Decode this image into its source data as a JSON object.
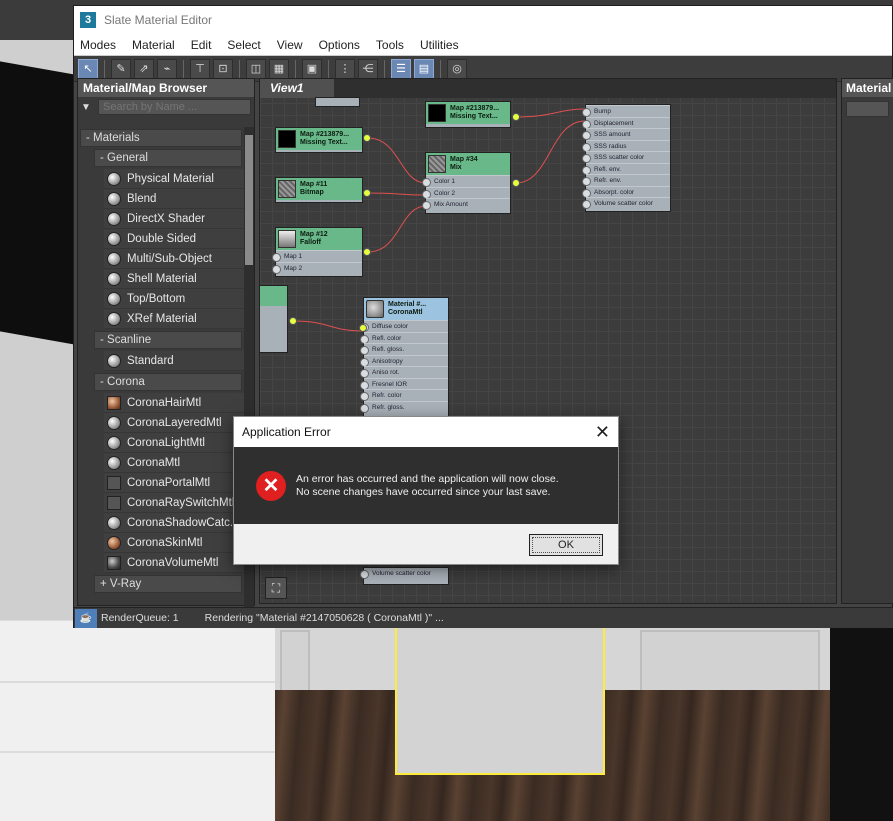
{
  "window": {
    "title": "Slate Material Editor",
    "app_icon": "3"
  },
  "menu": [
    "Modes",
    "Material",
    "Edit",
    "Select",
    "View",
    "Options",
    "Tools",
    "Utilities"
  ],
  "browser": {
    "title": "Material/Map Browser",
    "search_placeholder": "Search by Name ...",
    "groups": {
      "materials": "- Materials",
      "general": "- General",
      "scanline": "- Scanline",
      "corona": "- Corona",
      "vray": "+ V-Ray"
    },
    "general_items": [
      "Physical Material",
      "Blend",
      "DirectX Shader",
      "Double Sided",
      "Multi/Sub-Object",
      "Shell Material",
      "Top/Bottom",
      "XRef Material"
    ],
    "scanline_items": [
      "Standard"
    ],
    "corona_items": [
      "CoronaHairMtl",
      "CoronaLayeredMtl",
      "CoronaLightMtl",
      "CoronaMtl",
      "CoronaPortalMtl",
      "CoronaRaySwitchMtl",
      "CoronaShadowCatc...",
      "CoronaSkinMtl",
      "CoronaVolumeMtl"
    ]
  },
  "view": {
    "tab": "View1",
    "nodes": {
      "map_top": {
        "title": "Map #213879...",
        "sub": "Missing Text..."
      },
      "map_left": {
        "title": "Map #213879...",
        "sub": "Missing Text..."
      },
      "map11": {
        "title": "Map #11",
        "sub": "Bitmap"
      },
      "map12": {
        "title": "Map #12",
        "sub": "Falloff",
        "slots": [
          "Map 1",
          "Map 2"
        ]
      },
      "map34": {
        "title": "Map #34",
        "sub": "Mix",
        "slots": [
          "Color 1",
          "Color 2",
          "Mix Amount"
        ]
      },
      "big": {
        "slots": [
          "Bump",
          "Displacement",
          "SSS amount",
          "SSS radius",
          "SSS scatter color",
          "Refl. env.",
          "Refr. env.",
          "Absorpt. color",
          "Volume scatter color"
        ]
      },
      "corona": {
        "title": "Material #...",
        "sub": "CoronaMtl",
        "slots": [
          "Diffuse color",
          "Refl. color",
          "Refl. gloss.",
          "Anisotropy",
          "Aniso rot.",
          "Fresnel IOR",
          "Refr. color",
          "Refr. gloss."
        ],
        "bottom_slot": "Volume scatter color"
      }
    }
  },
  "right_panel": {
    "title": "Material"
  },
  "status": {
    "queue": "RenderQueue: 1",
    "message": "Rendering \"Material #2147050628  ( CoronaMtl )\" ..."
  },
  "dialog": {
    "title": "Application Error",
    "close": "✕",
    "line1": "An error has occurred and the application will now close.",
    "line2": "No scene changes have occurred since your last save.",
    "ok": "OK"
  }
}
